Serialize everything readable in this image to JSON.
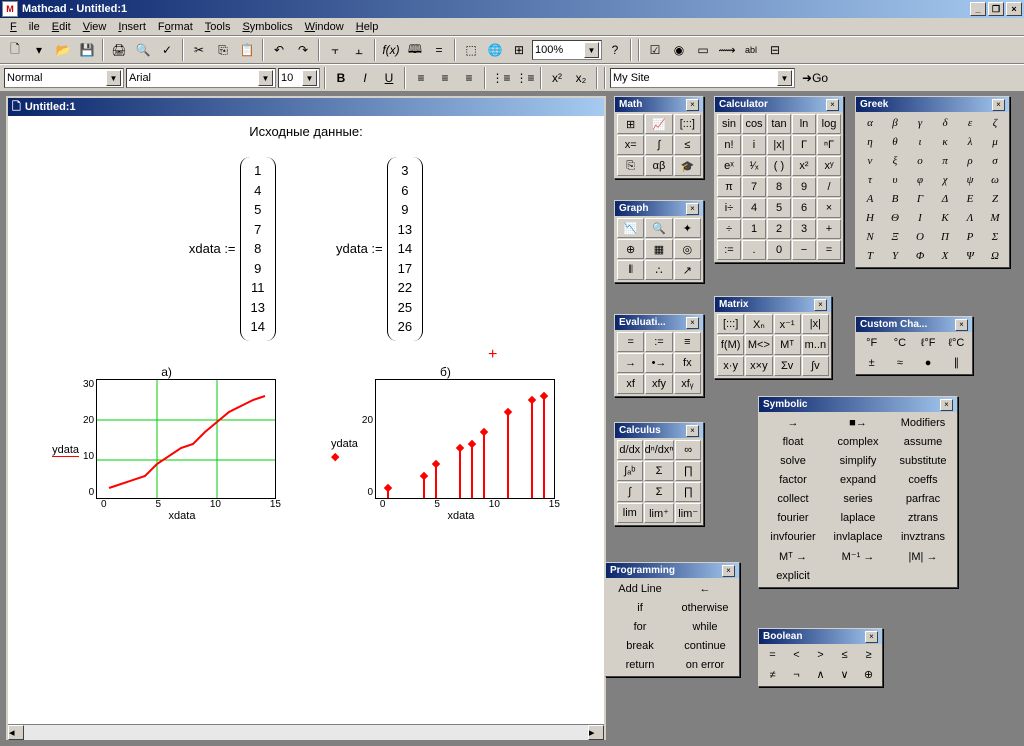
{
  "app": {
    "title": "Mathcad - Untitled:1",
    "doc_title": "Untitled:1"
  },
  "menu": {
    "file": "File",
    "edit": "Edit",
    "view": "View",
    "insert": "Insert",
    "format": "Format",
    "tools": "Tools",
    "symbolics": "Symbolics",
    "window": "Window",
    "help": "Help"
  },
  "format_bar": {
    "style": "Normal",
    "font": "Arial",
    "size": "10",
    "zoom": "100%",
    "site": "My Site",
    "go": "Go"
  },
  "worksheet": {
    "heading": "Исходные данные:",
    "xlabel": "xdata :=",
    "ylabel": "ydata :=",
    "xdata": [
      "1",
      "4",
      "5",
      "7",
      "8",
      "9",
      "11",
      "13",
      "14"
    ],
    "ydata": [
      "3",
      "6",
      "9",
      "13",
      "14",
      "17",
      "22",
      "25",
      "26"
    ],
    "chart_a": "a)",
    "chart_b": "б)",
    "axis_y": "ydata",
    "axis_x": "xdata"
  },
  "chart_data": [
    {
      "type": "line",
      "title": "a)",
      "x": [
        1,
        4,
        5,
        7,
        8,
        9,
        11,
        13,
        14
      ],
      "y": [
        3,
        6,
        9,
        13,
        14,
        17,
        22,
        25,
        26
      ],
      "xlabel": "xdata",
      "ylabel": "ydata",
      "xlim": [
        0,
        15
      ],
      "ylim": [
        0,
        30
      ],
      "xticks": [
        0,
        5,
        10,
        15
      ],
      "yticks": [
        0,
        10,
        20,
        30
      ],
      "grid": true
    },
    {
      "type": "stem",
      "title": "б)",
      "x": [
        1,
        4,
        5,
        7,
        8,
        9,
        11,
        13,
        14
      ],
      "y": [
        3,
        6,
        9,
        13,
        14,
        17,
        22,
        25,
        26
      ],
      "xlabel": "xdata",
      "ylabel": "ydata",
      "xlim": [
        0,
        15
      ],
      "ylim": [
        0,
        30
      ],
      "xticks": [
        0,
        5,
        10,
        15
      ],
      "yticks": [
        0,
        20
      ],
      "grid": false
    }
  ],
  "palettes": {
    "math": {
      "title": "Math"
    },
    "graph": {
      "title": "Graph"
    },
    "evaluation": {
      "title": "Evaluati..."
    },
    "calculus": {
      "title": "Calculus"
    },
    "programming": {
      "title": "Programming",
      "items": [
        "Add Line",
        "←",
        "if",
        "otherwise",
        "for",
        "while",
        "break",
        "continue",
        "return",
        "on error"
      ]
    },
    "calculator": {
      "title": "Calculator",
      "rows": [
        [
          "sin",
          "cos",
          "tan",
          "ln",
          "log"
        ],
        [
          "n!",
          "i",
          "|x|",
          "Γ",
          "ⁿΓ"
        ],
        [
          "eˣ",
          "¹⁄ₓ",
          "( )",
          "x²",
          "xʸ"
        ],
        [
          "π",
          "7",
          "8",
          "9",
          "/"
        ],
        [
          "i÷",
          "4",
          "5",
          "6",
          "×"
        ],
        [
          "÷",
          "1",
          "2",
          "3",
          "+"
        ],
        [
          ":=",
          ".",
          "0",
          "−",
          "="
        ]
      ]
    },
    "matrix": {
      "title": "Matrix",
      "rows": [
        [
          "[:::]",
          "Xₙ",
          "x⁻¹",
          "|x|"
        ],
        [
          "f(M)",
          "M<>",
          "Mᵀ",
          "m..n"
        ],
        [
          "x·y",
          "x×y",
          "Σv",
          "∫v"
        ]
      ]
    },
    "symbolic": {
      "title": "Symbolic",
      "rows": [
        [
          "→",
          "■→",
          "Modifiers"
        ],
        [
          "float",
          "complex",
          "assume"
        ],
        [
          "solve",
          "simplify",
          "substitute"
        ],
        [
          "factor",
          "expand",
          "coeffs"
        ],
        [
          "collect",
          "series",
          "parfrac"
        ],
        [
          "fourier",
          "laplace",
          "ztrans"
        ],
        [
          "invfourier",
          "invlaplace",
          "invztrans"
        ],
        [
          "Mᵀ →",
          "M⁻¹ →",
          "|M| →"
        ],
        [
          "explicit",
          "",
          ""
        ]
      ]
    },
    "boolean": {
      "title": "Boolean",
      "rows": [
        [
          "=",
          "<",
          ">",
          "≤",
          "≥"
        ],
        [
          "≠",
          "¬",
          "∧",
          "∨",
          "⊕"
        ]
      ]
    },
    "greek": {
      "title": "Greek",
      "rows": [
        [
          "α",
          "β",
          "γ",
          "δ",
          "ε",
          "ζ"
        ],
        [
          "η",
          "θ",
          "ι",
          "κ",
          "λ",
          "μ"
        ],
        [
          "ν",
          "ξ",
          "ο",
          "π",
          "ρ",
          "σ"
        ],
        [
          "τ",
          "υ",
          "φ",
          "χ",
          "ψ",
          "ω"
        ],
        [
          "Α",
          "Β",
          "Γ",
          "Δ",
          "Ε",
          "Ζ"
        ],
        [
          "Η",
          "Θ",
          "Ι",
          "Κ",
          "Λ",
          "Μ"
        ],
        [
          "Ν",
          "Ξ",
          "Ο",
          "Π",
          "Ρ",
          "Σ"
        ],
        [
          "Τ",
          "Υ",
          "Φ",
          "Χ",
          "Ψ",
          "Ω"
        ]
      ]
    },
    "customchar": {
      "title": "Custom Cha...",
      "rows": [
        [
          "°F",
          "°C",
          "ℓ°F",
          "ℓ°C"
        ],
        [
          "±",
          "≈",
          "●",
          "∥"
        ]
      ]
    }
  }
}
